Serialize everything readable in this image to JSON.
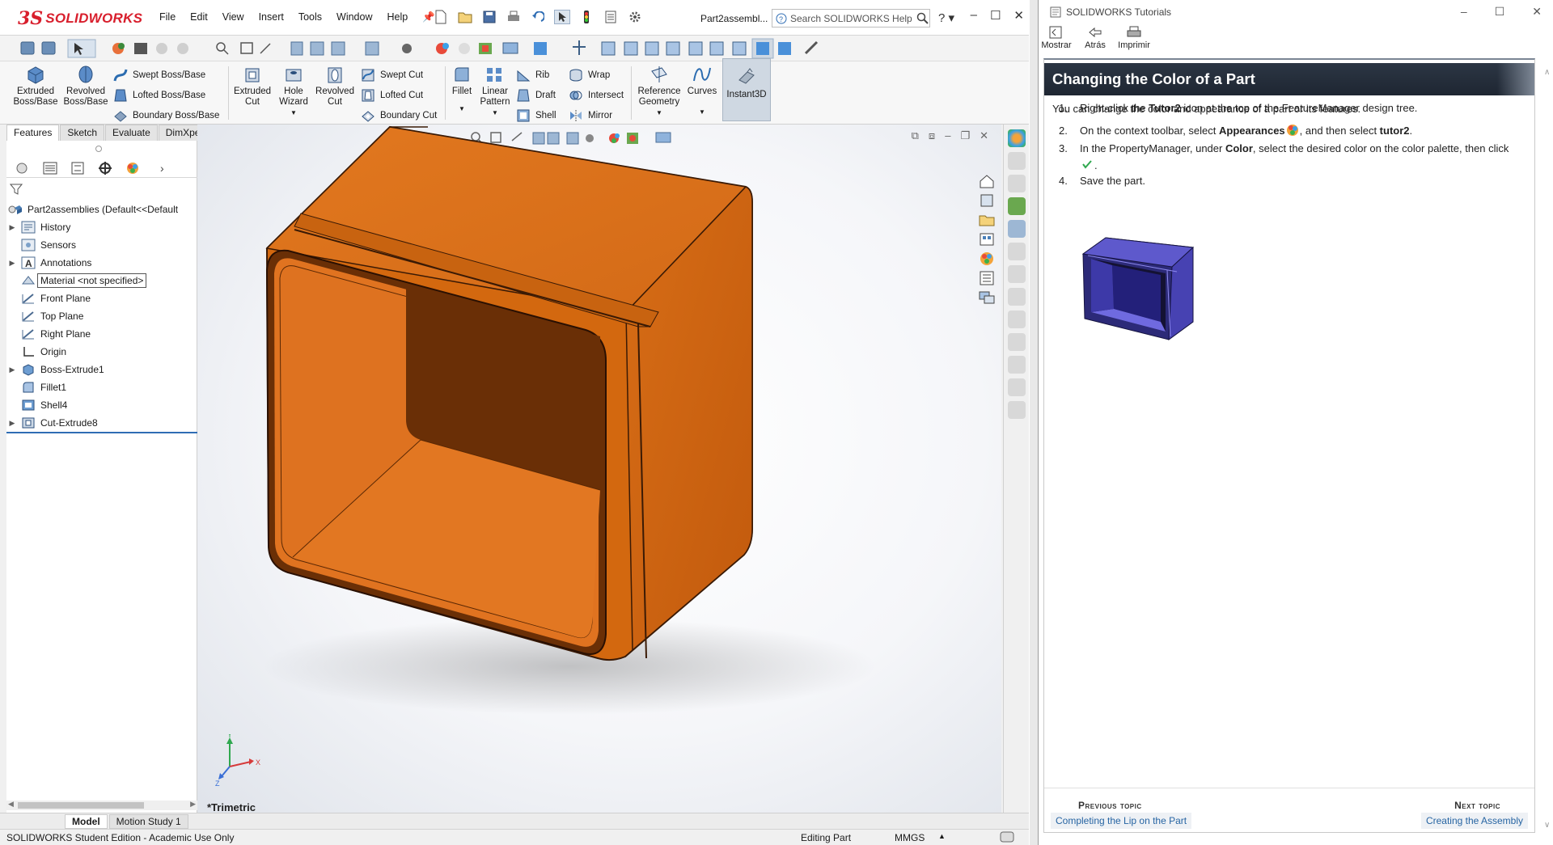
{
  "sw": {
    "brand_prefix": "3S",
    "brand": "SOLIDWORKS",
    "menu": [
      "File",
      "Edit",
      "View",
      "Insert",
      "Tools",
      "Window",
      "Help"
    ],
    "doc_name": "Part2assembl...",
    "help_placeholder": "Search SOLIDWORKS Help",
    "win_controls": [
      "–",
      "☐",
      "✕"
    ],
    "cmd": {
      "extruded_boss": "Extruded Boss/Base",
      "revolved_boss": "Revolved Boss/Base",
      "swept_boss": "Swept Boss/Base",
      "lofted_boss": "Lofted Boss/Base",
      "boundary_boss": "Boundary Boss/Base",
      "extruded_cut": "Extruded Cut",
      "hole_wizard": "Hole Wizard",
      "revolved_cut": "Revolved Cut",
      "swept_cut": "Swept Cut",
      "lofted_cut": "Lofted Cut",
      "boundary_cut": "Boundary Cut",
      "fillet": "Fillet",
      "linear_pattern": "Linear Pattern",
      "rib": "Rib",
      "draft": "Draft",
      "shell": "Shell",
      "wrap": "Wrap",
      "intersect": "Intersect",
      "mirror": "Mirror",
      "reference_geometry": "Reference Geometry",
      "curves": "Curves",
      "instant3d": "Instant3D"
    },
    "cmd_tabs": [
      "Features",
      "Sketch",
      "Evaluate",
      "DimXpert"
    ],
    "tree": {
      "root": "Part2assemblies  (Default<<Default",
      "items": [
        {
          "label": "History",
          "expandable": true,
          "icon": "history-icon"
        },
        {
          "label": "Sensors",
          "expandable": false,
          "icon": "sensors-icon"
        },
        {
          "label": "Annotations",
          "expandable": true,
          "icon": "annotations-icon"
        },
        {
          "label": "Material <not specified>",
          "expandable": false,
          "icon": "material-icon"
        },
        {
          "label": "Front Plane",
          "expandable": false,
          "icon": "plane-icon"
        },
        {
          "label": "Top Plane",
          "expandable": false,
          "icon": "plane-icon"
        },
        {
          "label": "Right Plane",
          "expandable": false,
          "icon": "plane-icon"
        },
        {
          "label": "Origin",
          "expandable": false,
          "icon": "origin-icon"
        },
        {
          "label": "Boss-Extrude1",
          "expandable": true,
          "icon": "extrude-icon"
        },
        {
          "label": "Fillet1",
          "expandable": false,
          "icon": "fillet-icon"
        },
        {
          "label": "Shell4",
          "expandable": false,
          "icon": "shell-icon"
        },
        {
          "label": "Cut-Extrude8",
          "expandable": true,
          "icon": "cut-extrude-icon"
        }
      ]
    },
    "view_label": "*Trimetric",
    "bottom_tabs": [
      "Model",
      "Motion Study 1"
    ],
    "status": {
      "left": "SOLIDWORKS Student Edition - Academic Use Only",
      "mode": "Editing Part",
      "units": "MMGS"
    },
    "colors": {
      "part": "#e07320",
      "part_dark": "#6a2f06",
      "accent": "#2f6db4"
    }
  },
  "tut": {
    "window_title": "SOLIDWORKS Tutorials",
    "toolbar": [
      "Mostrar",
      "Atrás",
      "Imprimir"
    ],
    "heading": "Changing the Color of a Part",
    "intro": "You can change the color and appearance of a part or its features.",
    "steps": [
      {
        "num": "1.",
        "pre": "Right-click the ",
        "b1": "Tutor2",
        "mid": " icon at the top of the FeatureManager design tree.",
        "b2": "",
        "post": ""
      },
      {
        "num": "2.",
        "pre": "On the context toolbar, select ",
        "b1": "Appearances",
        "mid": ", and then select ",
        "b2": "tutor2",
        "post": "."
      },
      {
        "num": "3.",
        "pre": "In the PropertyManager, under ",
        "b1": "Color",
        "mid": ", select the desired color on the color palette, then click ",
        "b2": "",
        "post": "."
      },
      {
        "num": "4.",
        "pre": "Save the part.",
        "b1": "",
        "mid": "",
        "b2": "",
        "post": ""
      }
    ],
    "prev_caption": "Previous topic",
    "prev_link": "Completing the Lip on the Part",
    "next_caption": "Next topic",
    "next_link": "Creating the Assembly",
    "colors": {
      "heading_bg": "#27303c",
      "link": "#2765a3",
      "tutor_part": "#5a55c8"
    }
  }
}
